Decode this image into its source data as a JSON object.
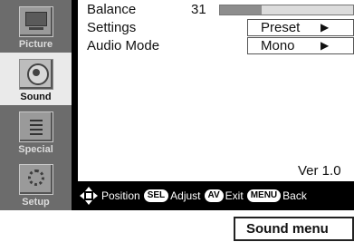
{
  "sidebar": {
    "items": [
      {
        "label": "Picture",
        "icon": "tv-icon"
      },
      {
        "label": "Sound",
        "icon": "speaker-icon"
      },
      {
        "label": "Special",
        "icon": "list-icon"
      },
      {
        "label": "Setup",
        "icon": "gear-icon"
      }
    ],
    "active": "Sound"
  },
  "settings": {
    "balance": {
      "label": "Balance",
      "value": "31",
      "fill_fraction": 0.31
    },
    "settings_row": {
      "label": "Settings",
      "value": "Preset",
      "arrow": "▶"
    },
    "audio_mode": {
      "label": "Audio Mode",
      "value": "Mono",
      "arrow": "▶"
    }
  },
  "version": "Ver 1.0",
  "helpbar": {
    "position_text": "Position",
    "sel_key": "SEL",
    "adjust_text": "Adjust",
    "av_key": "AV",
    "exit_text": "Exit",
    "menu_key": "MENU",
    "back_text": "Back"
  },
  "caption": "Sound menu",
  "colors": {
    "osd_background": "#000000",
    "sidebar_background": "#6c6c6c",
    "active_item_background": "#eaeaea",
    "content_background": "#ffffff",
    "bar_fill": "#8d8d8d"
  }
}
